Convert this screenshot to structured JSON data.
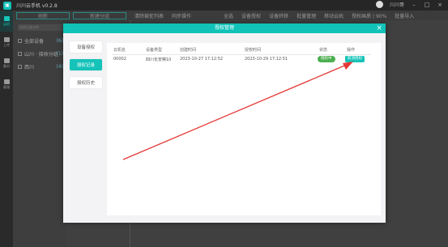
{
  "app": {
    "title": "川川云手机 v0.2.8",
    "user": "川川哥"
  },
  "toolbar": {
    "tab_refresh": "刷新",
    "tab_group": "新建分组",
    "items": [
      "清除被拒列表",
      "同步操作",
      "全选",
      "设备授权",
      "设备转移",
      "批量管理",
      "移动云机",
      "授权画质 | 90%",
      "批量导入"
    ]
  },
  "rail": {
    "items": [
      "云机",
      "上传",
      "备份",
      "客服"
    ]
  },
  "groups": {
    "search_placeholder": "搜索设备名称",
    "items": [
      {
        "label": "全部设备",
        "count": "(6)"
      },
      {
        "label": "山川 · 接收分组",
        "count": "(1)"
      },
      {
        "label": "西川",
        "count": "(4)"
      }
    ]
  },
  "modal": {
    "title": "授权管理",
    "close": "×",
    "tabs": [
      "设备授权",
      "授权记录",
      "授权历史"
    ],
    "active_tab": 1,
    "table": {
      "headers": [
        "云机名",
        "设备类型",
        "创建时间",
        "授权时间",
        "状态",
        "操作"
      ],
      "rows": [
        {
          "name": "00002",
          "type": "四川长安棋10",
          "created": "2023-10-27 17:12:52",
          "authorized": "2023-10-29 17:12:51",
          "status": "授权中",
          "action": "取消授权"
        }
      ]
    }
  },
  "colors": {
    "accent": "#15c3b9",
    "status_green": "#4caf50",
    "annotation_red": "#e53935"
  }
}
